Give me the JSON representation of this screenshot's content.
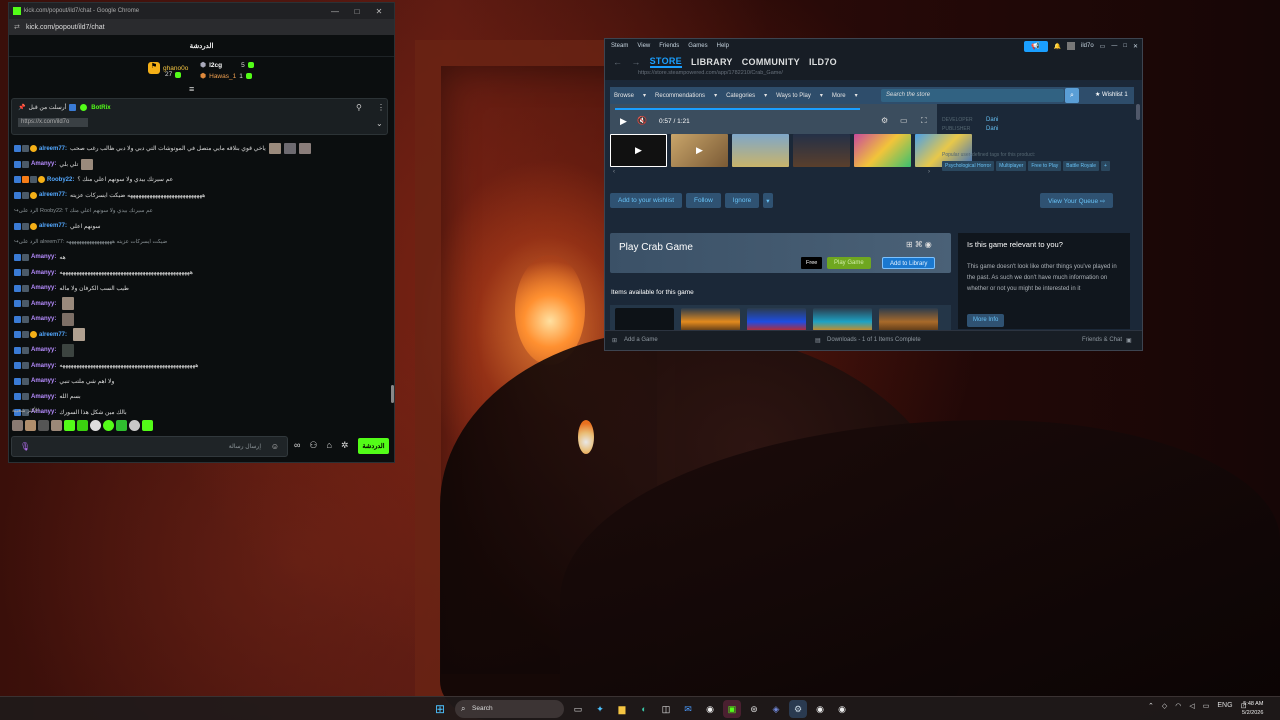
{
  "chrome": {
    "title": "kick.com/popout/ild7/chat - Google Chrome",
    "url": "kick.com/popout/ild7/chat",
    "window_buttons": [
      "—",
      "□",
      "✕"
    ]
  },
  "kick": {
    "header": "الدردشة",
    "leaderboard": [
      {
        "name": "ghano0o",
        "count": "27"
      },
      {
        "name": "l2cg",
        "count": "5"
      },
      {
        "name": "Hawas_1",
        "count": "1"
      }
    ],
    "pinned": {
      "author": "BotRix",
      "prefix": "أرسلت من قبل",
      "link": "https://x.com/ild7o"
    },
    "messages": [
      {
        "user": "alreem77:",
        "text": "ياخي قوي بنلاقه مايي متصل في الموتوشات التي دبي ولا دبي ظالب رغب صحب",
        "color": "#53a8ff",
        "thumbs": 3,
        "sys": false
      },
      {
        "user": "Amanyy:",
        "text": "تلي بلي",
        "color": "#b68cff",
        "thumbs": 1,
        "sys": false
      },
      {
        "user": "Rooby22:",
        "text": "عم سيرتك بيدي ولا سونهم اعلي منك ؟",
        "color": "#53a8ff",
        "thumbs": 0,
        "sys": false
      },
      {
        "user": "alreem77:",
        "text": "هههههههههههههههههههههههههههه ضيكت ايسركات عزيته",
        "color": "#53a8ff",
        "thumbs": 0,
        "sys": false
      },
      {
        "user": "",
        "text": "الرد على Rooby22: عم سيرتك بيدي ولا سونهم اعلي منك ؟",
        "color": "#8a9296",
        "thumbs": 0,
        "sys": true
      },
      {
        "user": "alreem77:",
        "text": "سونهم اعلي",
        "color": "#53a8ff",
        "thumbs": 0,
        "sys": false
      },
      {
        "user": "",
        "text": "الرد على alreem77: ضيكت ايسركات عزيته ههههههههههههههههههه",
        "color": "#8a9296",
        "thumbs": 0,
        "sys": true
      },
      {
        "user": "Amanyy:",
        "text": "هه",
        "color": "#b68cff",
        "thumbs": 0,
        "sys": false
      },
      {
        "user": "Amanyy:",
        "text": "هههههههههههههههههههههههههههههههههههههههههههههههه",
        "color": "#b68cff",
        "thumbs": 0,
        "sys": false
      },
      {
        "user": "Amanyy:",
        "text": "طيب السب الكرفان ولا ماله",
        "color": "#b68cff",
        "thumbs": 0,
        "sys": false
      },
      {
        "user": "Amanyy:",
        "text": "",
        "color": "#b68cff",
        "thumbs": 1,
        "sys": false
      },
      {
        "user": "Amanyy:",
        "text": "",
        "color": "#b68cff",
        "thumbs": 1,
        "sys": false
      },
      {
        "user": "alreem77:",
        "text": "",
        "color": "#53a8ff",
        "thumbs": 1,
        "sys": false
      },
      {
        "user": "Amanyy:",
        "text": "",
        "color": "#b68cff",
        "thumbs": 1,
        "sys": false
      },
      {
        "user": "Amanyy:",
        "text": "هههههههههههههههههههههههههههههههههههههههههههههههههه",
        "color": "#b68cff",
        "thumbs": 0,
        "sys": false
      },
      {
        "user": "Amanyy:",
        "text": "ولا اهم شي ملتب تنبي",
        "color": "#b68cff",
        "thumbs": 0,
        "sys": false
      },
      {
        "user": "Amanyy:",
        "text": "بسم الله",
        "color": "#b68cff",
        "thumbs": 0,
        "sys": false
      },
      {
        "user": "Amanyy:",
        "text": "بالك مين شكل هذا السورك",
        "color": "#b68cff",
        "thumbs": 0,
        "sys": false
      }
    ],
    "popular_label": "الأكثر شعبية",
    "input_placeholder": "إرسال رسالة",
    "send_label": "الدردشة"
  },
  "steam": {
    "menu": [
      "Steam",
      "View",
      "Friends",
      "Games",
      "Help"
    ],
    "account": "ild7o",
    "nav": {
      "store": "STORE",
      "library": "LIBRARY",
      "community": "COMMUNITY",
      "user": "ILD7O"
    },
    "url": "https://store.steampowered.com/app/1782210/Crab_Game/",
    "subnav": [
      "Browse",
      "Recommendations",
      "Categories",
      "Ways to Play",
      "More"
    ],
    "search_placeholder": "Search the store",
    "wishlist": "Wishlist",
    "wishlist_count": "1",
    "video_time": "0:57 / 1:21",
    "developer_label": "DEVELOPER",
    "developer": "Dani",
    "publisher_label": "PUBLISHER",
    "publisher": "Dani",
    "tags_title": "Popular user-defined tags for this product:",
    "tags": [
      "Psychological Horror",
      "Multiplayer",
      "Free to Play",
      "Battle Royale",
      "+"
    ],
    "actions": [
      "Add to your wishlist",
      "Follow",
      "Ignore"
    ],
    "view_queue": "View Your Queue",
    "game_title": "Play Crab Game",
    "free_label": "Free",
    "play_label": "Play Game",
    "add_library": "Add to Library",
    "items_title": "Items available for this game",
    "relevance": {
      "title": "Is this game relevant to you?",
      "body": "This game doesn't look like other things you've played in the past. As such we don't have much information on whether or not you might be interested in it",
      "more": "More Info"
    },
    "footer": {
      "add": "Add a Game",
      "downloads": "Downloads - 1 of 1 Items Complete",
      "friends": "Friends & Chat"
    }
  },
  "taskbar": {
    "search": "Search",
    "lang": "ENG",
    "time": "5:48 AM",
    "date": "5/2/2026"
  }
}
